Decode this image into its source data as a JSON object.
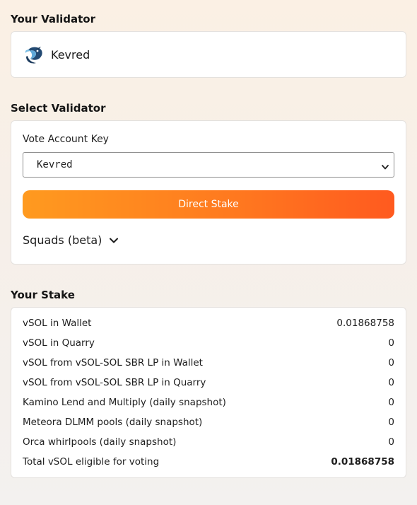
{
  "your_validator": {
    "title": "Your Validator",
    "name": "Kevred",
    "logo_icon": "kevred-bird-logo"
  },
  "select_validator": {
    "title": "Select Validator",
    "field_label": "Vote Account Key",
    "selected_value": "Kevred",
    "button_label": "Direct Stake",
    "squads_label": "Squads (beta)",
    "button_gradient": [
      "#ff9a1f",
      "#ff5a1f"
    ]
  },
  "your_stake": {
    "title": "Your Stake",
    "rows": [
      {
        "label": "vSOL in Wallet",
        "value": "0.01868758"
      },
      {
        "label": "vSOL in Quarry",
        "value": "0"
      },
      {
        "label": "vSOL from vSOL-SOL SBR LP in Wallet",
        "value": "0"
      },
      {
        "label": "vSOL from vSOL-SOL SBR LP in Quarry",
        "value": "0"
      },
      {
        "label": "Kamino Lend and Multiply (daily snapshot)",
        "value": "0"
      },
      {
        "label": "Meteora DLMM pools (daily snapshot)",
        "value": "0"
      },
      {
        "label": "Orca whirlpools (daily snapshot)",
        "value": "0"
      },
      {
        "label": "Total vSOL eligible for voting",
        "value": "0.01868758"
      }
    ]
  }
}
